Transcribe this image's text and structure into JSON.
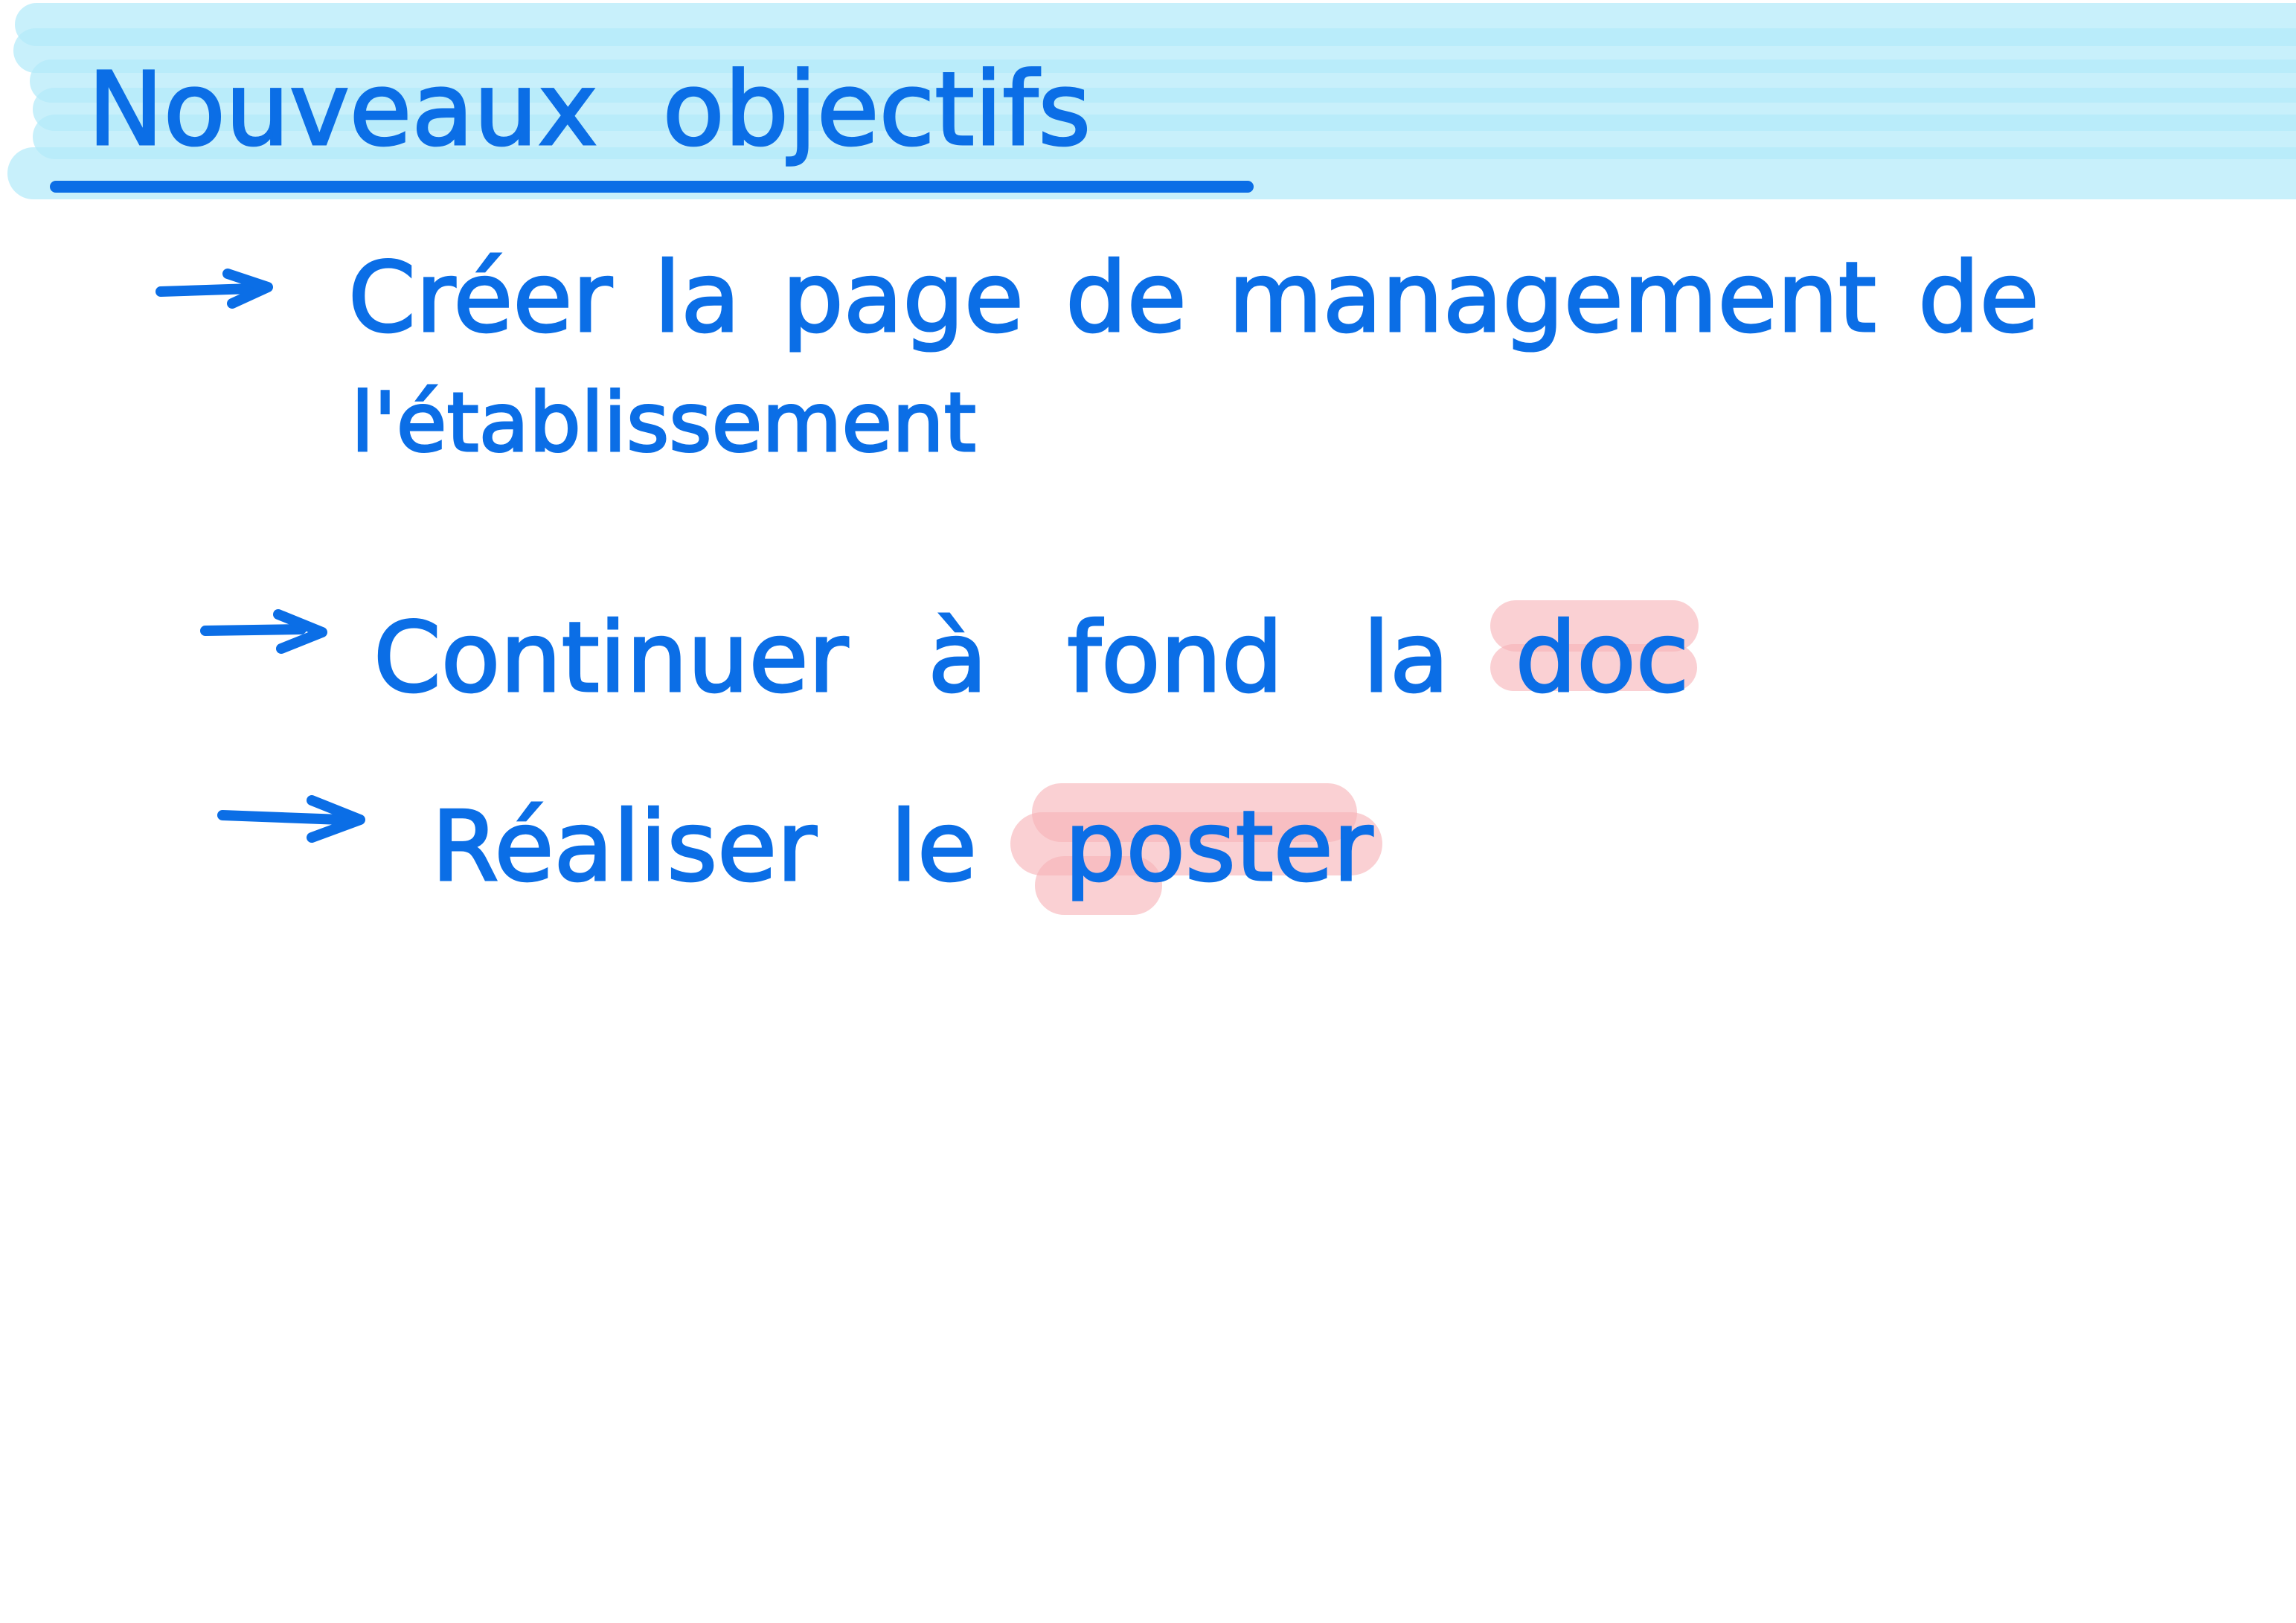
{
  "title": "Nouveaux objectifs",
  "items": [
    {
      "icon": "arrow-icon",
      "text": "Créer la page de management de",
      "text_continued": "l'établissement"
    },
    {
      "icon": "arrow-icon",
      "text": "Continuer à fond la",
      "highlight": "doc"
    },
    {
      "icon": "arrow-icon",
      "text": "Réaliser le",
      "highlight": "poster"
    }
  ],
  "colors": {
    "ink": "#0b6ee6",
    "header_band": "#b3eafa",
    "highlight": "#f7b3b8"
  }
}
